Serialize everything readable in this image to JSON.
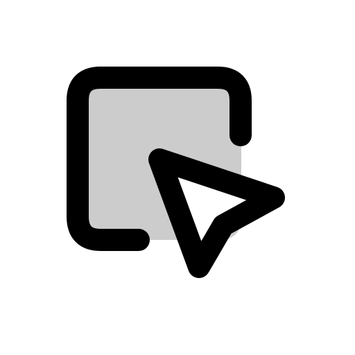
{
  "icon": {
    "name": "select-area-cursor-icon",
    "colors": {
      "fill": "#cccccc",
      "stroke": "#000000",
      "background": "#ffffff",
      "cursor_fill": "#ffffff"
    }
  }
}
